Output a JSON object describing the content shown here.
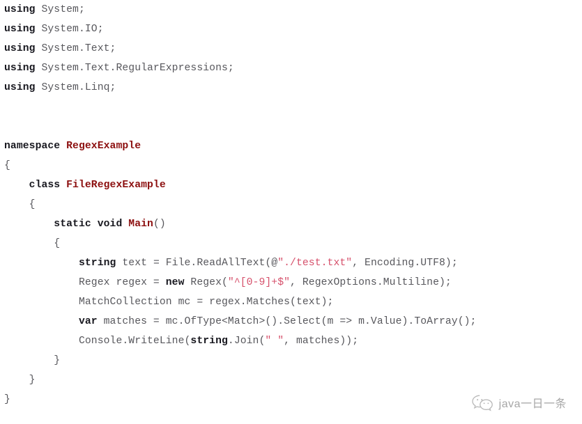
{
  "code": {
    "language": "csharp",
    "background_color": "#ffffff",
    "colors": {
      "plain": "#57575c",
      "keyword": "#18181f",
      "type": "#8c0f0f",
      "string": "#d6506b"
    },
    "lines": [
      {
        "tokens": [
          {
            "t": "using ",
            "c": "keyword"
          },
          {
            "t": "System;",
            "c": "plain"
          }
        ]
      },
      {
        "tokens": [
          {
            "t": "using ",
            "c": "keyword"
          },
          {
            "t": "System.IO;",
            "c": "plain"
          }
        ]
      },
      {
        "tokens": [
          {
            "t": "using ",
            "c": "keyword"
          },
          {
            "t": "System.Text;",
            "c": "plain"
          }
        ]
      },
      {
        "tokens": [
          {
            "t": "using ",
            "c": "keyword"
          },
          {
            "t": "System.Text.RegularExpressions;",
            "c": "plain"
          }
        ]
      },
      {
        "tokens": [
          {
            "t": "using ",
            "c": "keyword"
          },
          {
            "t": "System.Linq;",
            "c": "plain"
          }
        ]
      },
      {
        "tokens": []
      },
      {
        "tokens": []
      },
      {
        "tokens": [
          {
            "t": "namespace ",
            "c": "keyword"
          },
          {
            "t": "RegexExample",
            "c": "type"
          }
        ]
      },
      {
        "tokens": [
          {
            "t": "{",
            "c": "plain"
          }
        ]
      },
      {
        "tokens": [
          {
            "t": "    class ",
            "c": "keyword"
          },
          {
            "t": "FileRegexExample",
            "c": "type"
          }
        ]
      },
      {
        "tokens": [
          {
            "t": "    {",
            "c": "plain"
          }
        ]
      },
      {
        "tokens": [
          {
            "t": "        static void ",
            "c": "keyword"
          },
          {
            "t": "Main",
            "c": "type"
          },
          {
            "t": "()",
            "c": "plain"
          }
        ]
      },
      {
        "tokens": [
          {
            "t": "        {",
            "c": "plain"
          }
        ]
      },
      {
        "tokens": [
          {
            "t": "            string ",
            "c": "keyword"
          },
          {
            "t": "text = File.ReadAllText(@",
            "c": "plain"
          },
          {
            "t": "\"./test.txt\"",
            "c": "string"
          },
          {
            "t": ", Encoding.UTF8);",
            "c": "plain"
          }
        ]
      },
      {
        "tokens": [
          {
            "t": "            Regex regex = ",
            "c": "plain"
          },
          {
            "t": "new ",
            "c": "keyword"
          },
          {
            "t": "Regex(",
            "c": "plain"
          },
          {
            "t": "\"^[0-9]+$\"",
            "c": "string"
          },
          {
            "t": ", RegexOptions.Multiline);",
            "c": "plain"
          }
        ]
      },
      {
        "tokens": [
          {
            "t": "            MatchCollection mc = regex.Matches(text);",
            "c": "plain"
          }
        ]
      },
      {
        "tokens": [
          {
            "t": "            var ",
            "c": "keyword"
          },
          {
            "t": "matches = mc.OfType<Match>().Select(m => m.Value).ToArray();",
            "c": "plain"
          }
        ]
      },
      {
        "tokens": [
          {
            "t": "            Console.WriteLine(",
            "c": "plain"
          },
          {
            "t": "string",
            "c": "keyword"
          },
          {
            "t": ".Join(",
            "c": "plain"
          },
          {
            "t": "\" \"",
            "c": "string"
          },
          {
            "t": ", matches));",
            "c": "plain"
          }
        ]
      },
      {
        "tokens": [
          {
            "t": "        }",
            "c": "plain"
          }
        ]
      },
      {
        "tokens": [
          {
            "t": "    }",
            "c": "plain"
          }
        ]
      },
      {
        "tokens": [
          {
            "t": "}",
            "c": "plain"
          }
        ]
      }
    ]
  },
  "watermark": {
    "label": "java一日一条",
    "icon": "wechat-logo-icon",
    "color": "#707070"
  }
}
